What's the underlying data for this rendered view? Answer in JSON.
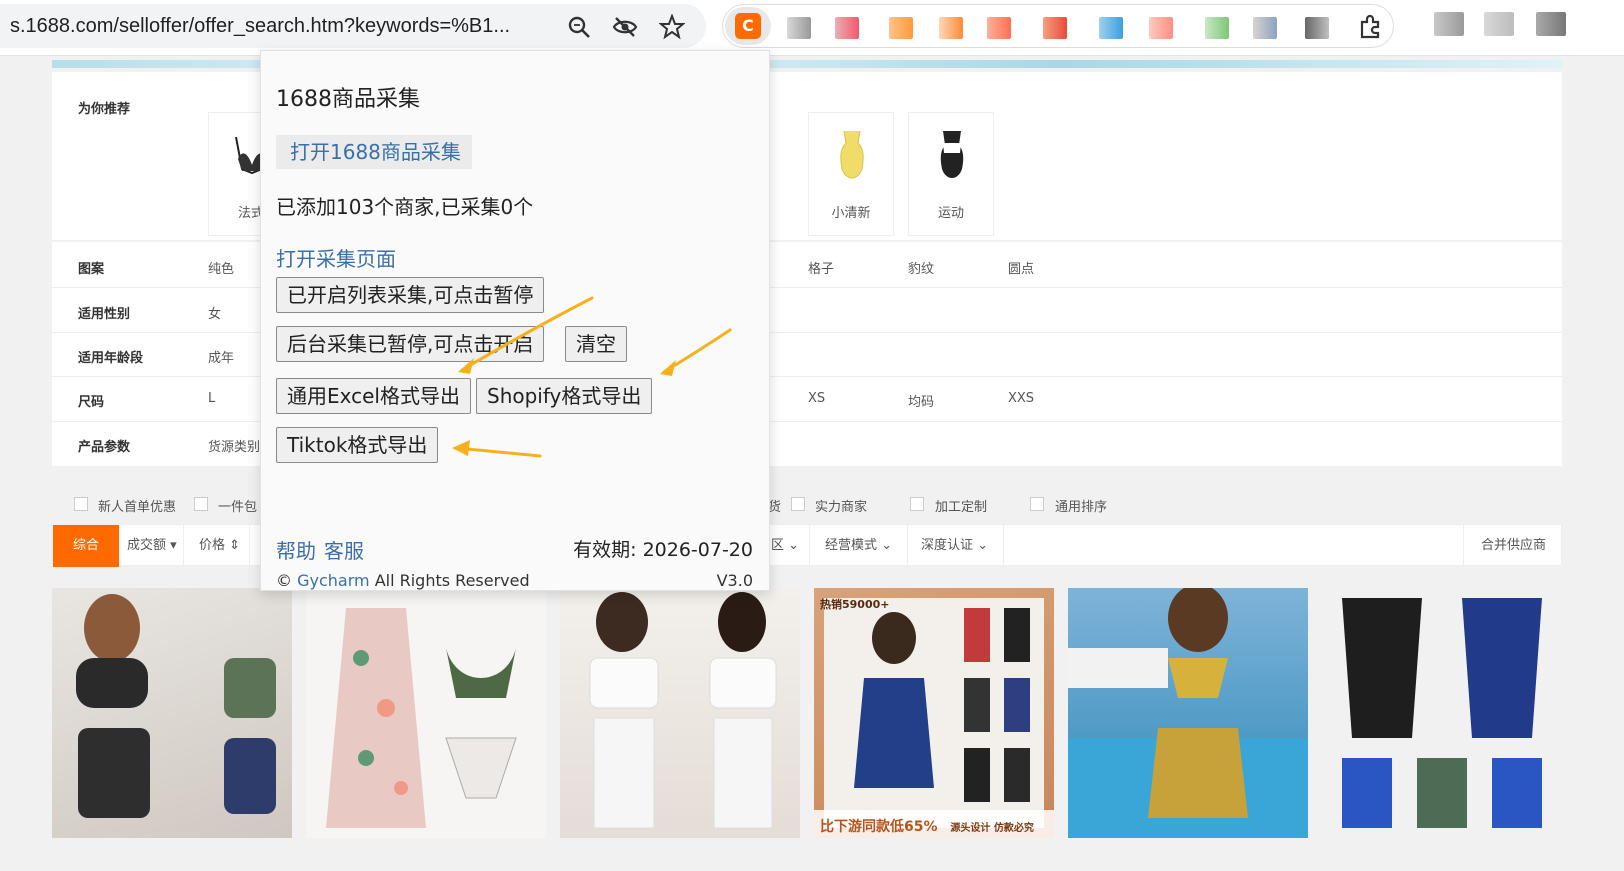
{
  "browser": {
    "url": "s.1688.com/selloffer/offer_search.htm?keywords=%B1...",
    "icons": [
      "zoom-icon",
      "eye-off-icon",
      "star-icon",
      "puzzle-icon"
    ]
  },
  "recommend": {
    "label": "为你推荐",
    "tiles": [
      {
        "caption": "法式"
      },
      {
        "caption": "小清新"
      },
      {
        "caption": "运动"
      }
    ]
  },
  "filters": [
    {
      "label": "图案",
      "values": [
        "纯色",
        "格子",
        "豹纹",
        "圆点"
      ]
    },
    {
      "label": "适用性别",
      "values": [
        "女"
      ]
    },
    {
      "label": "适用年龄段",
      "values": [
        "成年"
      ]
    },
    {
      "label": "尺码",
      "values": [
        "L",
        "XS",
        "均码",
        "XXS"
      ]
    },
    {
      "label": "产品参数",
      "values": [
        "货源类别"
      ]
    }
  ],
  "checks": [
    "新人首单优惠",
    "一件包",
    "货",
    "实力商家",
    "加工定制",
    "通用排序"
  ],
  "sort": {
    "active": "综合",
    "items": [
      "成交额",
      "价格",
      "区",
      "经营模式",
      "深度认证"
    ],
    "right": "合并供应商"
  },
  "products": {
    "tag_hot": "热销59000+",
    "bottom_left": "比下游同款低65%",
    "bottom_right": "源头设计 仿款必究"
  },
  "popup": {
    "title": "1688商品采集",
    "open_button": "打开1688商品采集",
    "stat": "已添加103个商家,已采集0个",
    "open_page_link": "打开采集页面",
    "list_collect": "已开启列表采集,可点击暂停",
    "bg_collect": "后台采集已暂停,可点击开启",
    "clear": "清空",
    "excel_export": "通用Excel格式导出",
    "shopify_export": "Shopify格式导出",
    "tiktok_export": "Tiktok格式导出",
    "help": "帮助",
    "service": "客服",
    "expiry": "有效期: 2026-07-20",
    "copyright_prefix": "©",
    "brand": "Gycharm",
    "copyright_suffix": "All Rights Reserved",
    "version": "V3.0"
  },
  "colors": {
    "accent": "#ff6a00",
    "link": "#3a6fa8",
    "arrow": "#f5b11c"
  }
}
